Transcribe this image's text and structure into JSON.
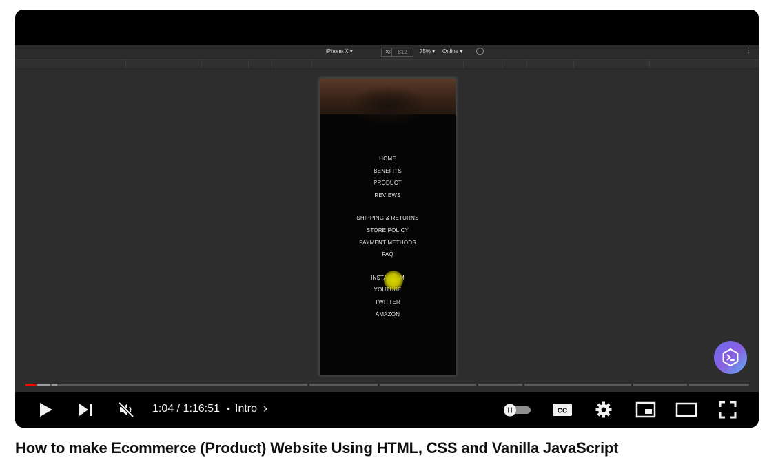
{
  "devtools": {
    "device": "iPhone X ▾",
    "width": "375",
    "height": "812",
    "times": "×",
    "zoom": "75% ▾",
    "network": "Online ▾"
  },
  "phone_menu": {
    "group1": [
      "HOME",
      "BENEFITS",
      "PRODUCT",
      "REVIEWS"
    ],
    "group2": [
      "SHIPPING & RETURNS",
      "STORE POLICY",
      "PAYMENT METHODS",
      "FAQ"
    ],
    "group3": [
      "INSTAGRAM",
      "YOUTUBE",
      "TWITTER",
      "AMAZON"
    ]
  },
  "controls": {
    "time": "1:04 / 1:16:51",
    "separator": "•",
    "chapter": "Intro",
    "chapter_chevron": "›",
    "cc_label": "CC"
  },
  "progress": {
    "current_seconds": 64,
    "total_seconds": 4611,
    "played_color": "#ff0000"
  },
  "video_title": "How to make Ecommerce (Product) Website Using HTML, CSS and Vanilla JavaScript",
  "icons": {
    "play": "play-icon",
    "next": "next-icon",
    "mute": "muted-volume-icon",
    "autoplay": "autoplay-toggle-icon",
    "captions": "captions-icon",
    "settings": "gear-icon",
    "miniplayer": "miniplayer-icon",
    "theater": "theater-mode-icon",
    "fullscreen": "fullscreen-icon",
    "channel": "channel-watermark-icon"
  }
}
